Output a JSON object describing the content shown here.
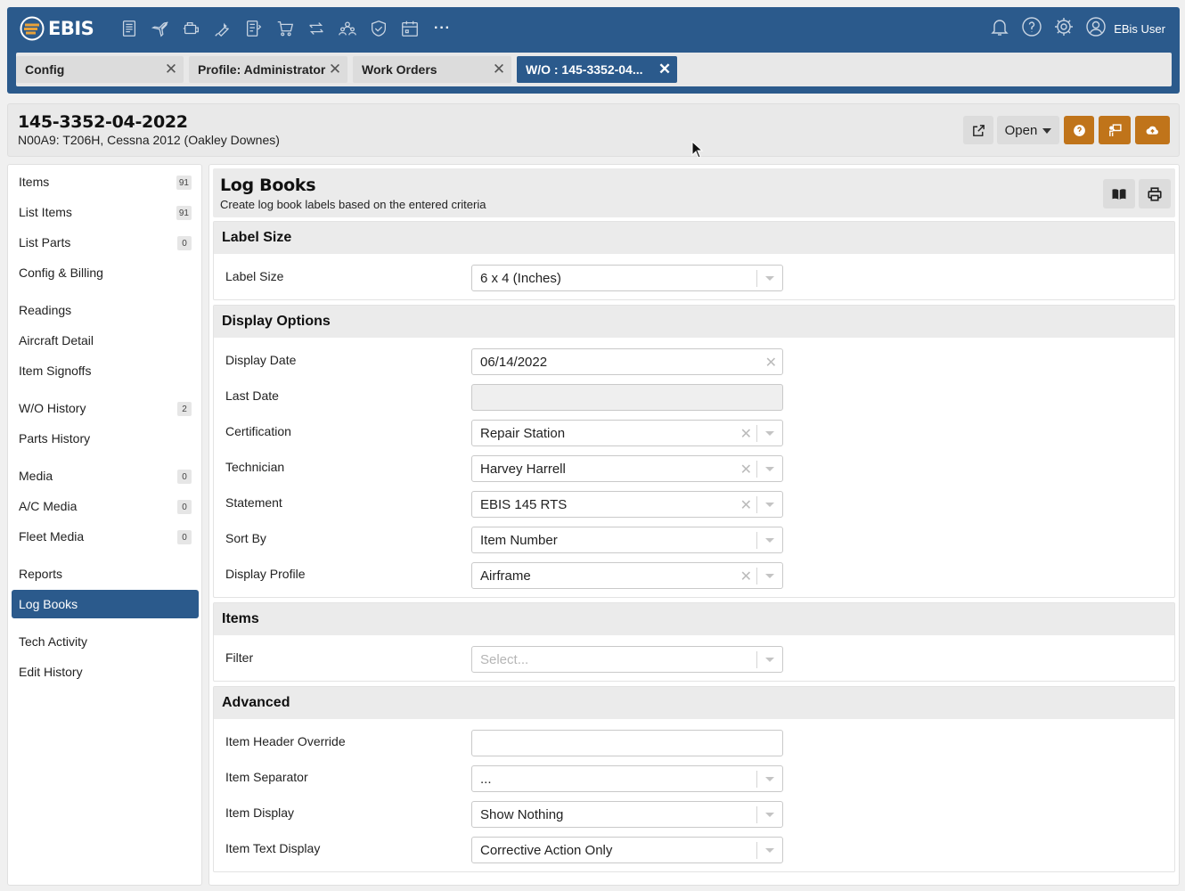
{
  "app": {
    "logo_text": "EBIS",
    "user_label": "EBis User"
  },
  "nav_icons": [
    "document-icon",
    "airplane-icon",
    "engine-icon",
    "wrench-icon",
    "checklist-icon",
    "cart-icon",
    "transfer-icon",
    "users-icon",
    "shield-icon",
    "calendar-icon"
  ],
  "nav_more": "···",
  "tabs": [
    {
      "label": "Config"
    },
    {
      "label": "Profile: Administrator"
    },
    {
      "label": "Work Orders"
    },
    {
      "label": "W/O : 145-3352-04..."
    }
  ],
  "header": {
    "title": "145-3352-04-2022",
    "subtitle": "N00A9: T206H, Cessna 2012 (Oakley Downes)",
    "open_label": "Open"
  },
  "sidebar": {
    "items": [
      {
        "label": "Items",
        "badge": "91"
      },
      {
        "label": "List Items",
        "badge": "91"
      },
      {
        "label": "List Parts",
        "badge": "0"
      },
      {
        "label": "Config & Billing",
        "badge": ""
      },
      {
        "label": "Readings",
        "badge": ""
      },
      {
        "label": "Aircraft Detail",
        "badge": ""
      },
      {
        "label": "Item Signoffs",
        "badge": ""
      },
      {
        "label": "W/O History",
        "badge": "2"
      },
      {
        "label": "Parts History",
        "badge": ""
      },
      {
        "label": "Media",
        "badge": "0"
      },
      {
        "label": "A/C Media",
        "badge": "0"
      },
      {
        "label": "Fleet Media",
        "badge": "0"
      },
      {
        "label": "Reports",
        "badge": ""
      },
      {
        "label": "Log Books",
        "badge": ""
      },
      {
        "label": "Tech Activity",
        "badge": ""
      },
      {
        "label": "Edit History",
        "badge": ""
      }
    ]
  },
  "main": {
    "title": "Log Books",
    "subtitle": "Create log book labels based on the entered criteria",
    "sections": {
      "label_size": {
        "title": "Label Size",
        "fields": [
          {
            "label": "Label Size",
            "value": "6 x 4 (Inches)"
          }
        ]
      },
      "display_options": {
        "title": "Display Options",
        "fields": [
          {
            "label": "Display Date",
            "value": "06/14/2022"
          },
          {
            "label": "Last Date",
            "value": ""
          },
          {
            "label": "Certification",
            "value": "Repair Station"
          },
          {
            "label": "Technician",
            "value": "Harvey Harrell"
          },
          {
            "label": "Statement",
            "value": "EBIS 145 RTS"
          },
          {
            "label": "Sort By",
            "value": "Item Number"
          },
          {
            "label": "Display Profile",
            "value": "Airframe"
          }
        ]
      },
      "items": {
        "title": "Items",
        "fields": [
          {
            "label": "Filter",
            "value": "",
            "placeholder": "Select..."
          }
        ]
      },
      "advanced": {
        "title": "Advanced",
        "fields": [
          {
            "label": "Item Header Override",
            "value": ""
          },
          {
            "label": "Item Separator",
            "value": "..."
          },
          {
            "label": "Item Display",
            "value": "Show Nothing"
          },
          {
            "label": "Item Text Display",
            "value": "Corrective Action Only"
          }
        ]
      }
    }
  },
  "colors": {
    "primary": "#2b5a8c",
    "accent": "#c0741a",
    "panel": "#ebebeb"
  }
}
